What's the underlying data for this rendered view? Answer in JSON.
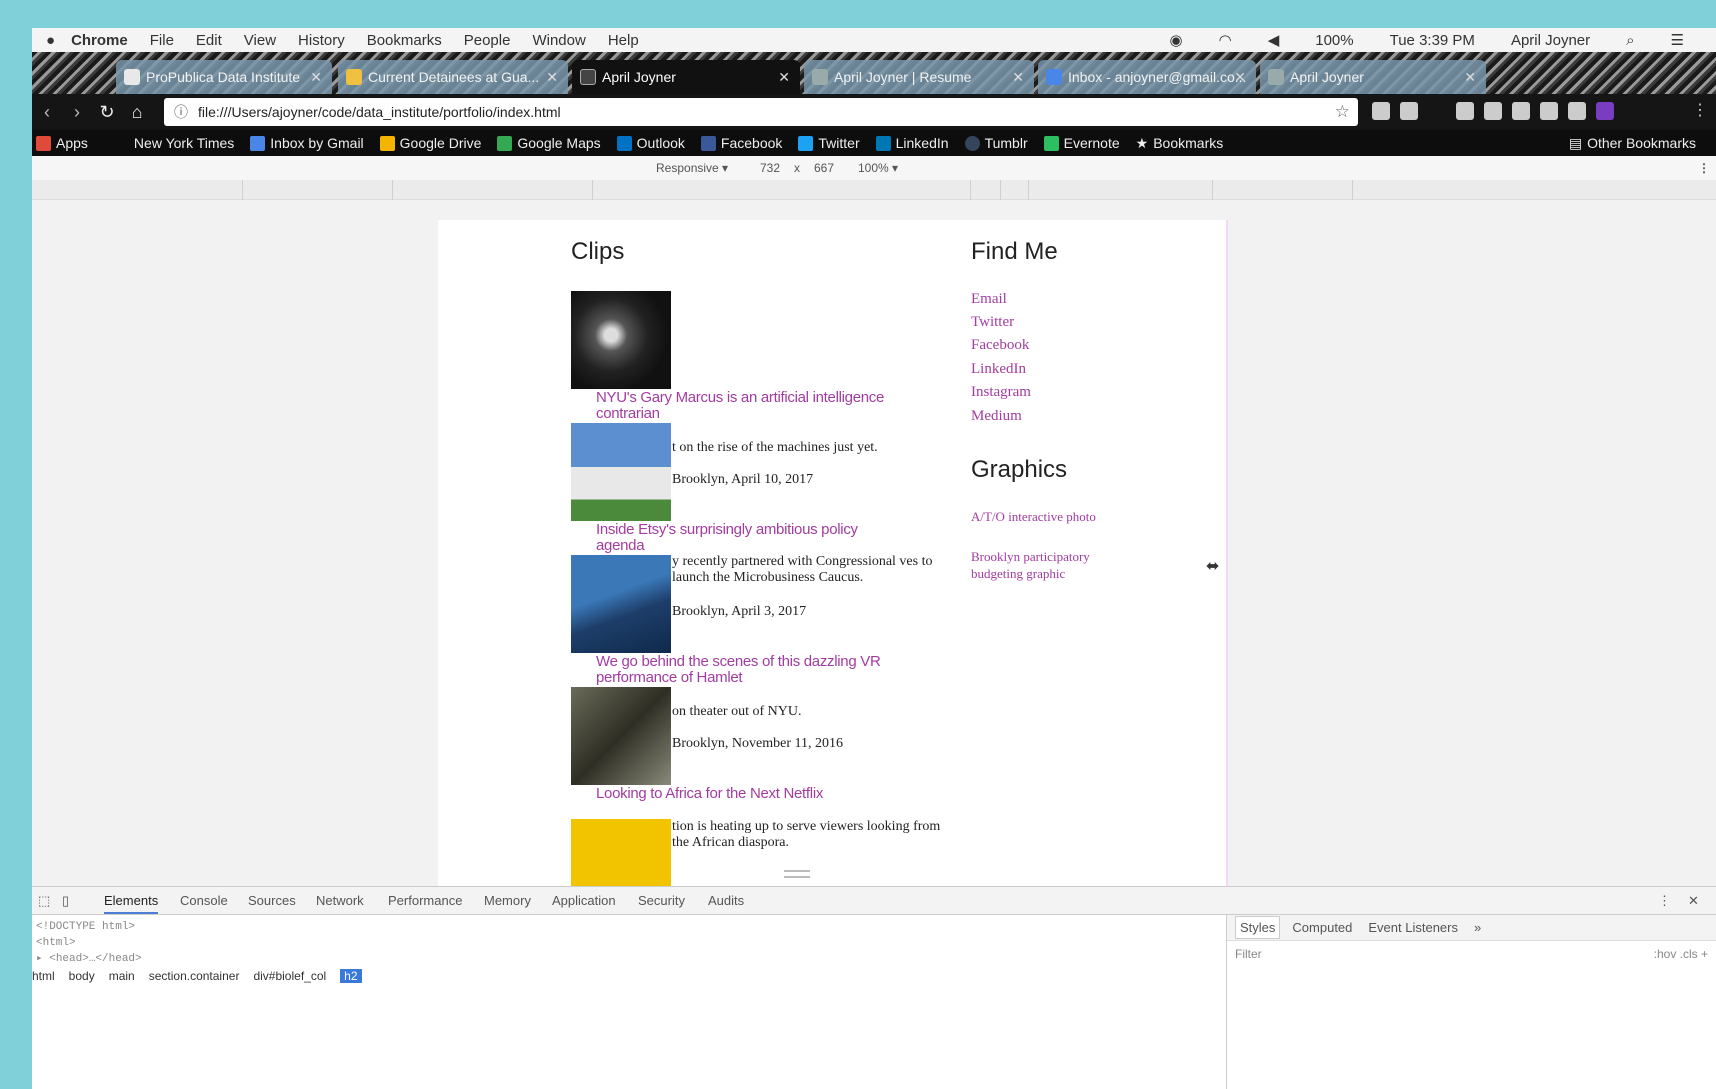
{
  "menubar": {
    "apple": "",
    "items": [
      "Chrome",
      "File",
      "Edit",
      "View",
      "History",
      "Bookmarks",
      "People",
      "Window",
      "Help"
    ],
    "battery": "100%",
    "clock": "Tue 3:39 PM",
    "user": "April Joyner"
  },
  "tabs": [
    {
      "label": "ProPublica Data Institute"
    },
    {
      "label": "Current Detainees at Gua..."
    },
    {
      "label": "April Joyner"
    },
    {
      "label": "April Joyner | Resume"
    },
    {
      "label": "Inbox - anjoyner@gmail.co..."
    },
    {
      "label": "April Joyner"
    }
  ],
  "toolbar": {
    "url": "file:///Users/ajoyner/code/data_institute/portfolio/index.html"
  },
  "bookmarks": [
    {
      "label": "Apps",
      "color": "#e04a3a"
    },
    {
      "label": "New York Times",
      "color": ""
    },
    {
      "label": "Inbox by Gmail",
      "color": "#4a86e8"
    },
    {
      "label": "Google Drive",
      "color": "#f4b400"
    },
    {
      "label": "Google Maps",
      "color": "#34a853"
    },
    {
      "label": "Outlook",
      "color": "#0072c6"
    },
    {
      "label": "Facebook",
      "color": "#3b5998"
    },
    {
      "label": "Twitter",
      "color": "#1da1f2"
    },
    {
      "label": "LinkedIn",
      "color": "#0077b5"
    },
    {
      "label": "Tumblr",
      "color": "#35465c"
    },
    {
      "label": "Evernote",
      "color": "#2dbe60"
    },
    {
      "label": "Bookmarks",
      "color": ""
    }
  ],
  "other_bookmarks": "Other Bookmarks",
  "device": {
    "mode": "Responsive",
    "width": "732",
    "times": "x",
    "height": "667",
    "zoom": "100%"
  },
  "page": {
    "clips_heading": "Clips",
    "findme_heading": "Find Me",
    "graphics_heading": "Graphics",
    "clips": [
      {
        "link": "NYU's Gary Marcus is an artificial intelligence contrarian",
        "desc": "",
        "date": ""
      },
      {
        "link": "",
        "desc": "t on the rise of the machines just yet.",
        "date": "Brooklyn, April 10, 2017"
      },
      {
        "link": "Inside Etsy's surprisingly ambitious policy agenda",
        "desc": "y recently partnered with Congressional ves to launch the Microbusiness Caucus.",
        "date": "Brooklyn, April 3, 2017"
      },
      {
        "link": "We go behind the scenes of this dazzling VR performance of Hamlet",
        "desc": "on theater out of NYU.",
        "date": "Brooklyn, November 11, 2016"
      },
      {
        "link": "Looking to Africa for the Next Netflix",
        "desc": "tion is heating up to serve viewers looking from the African diaspora.",
        "date": ""
      }
    ],
    "findme_links": [
      "Email",
      "Twitter",
      "Facebook",
      "LinkedIn",
      "Instagram",
      "Medium"
    ],
    "graphics_links": [
      "A/T/O interactive photo",
      "Brooklyn participatory budgeting graphic"
    ]
  },
  "devtools": {
    "tabs": [
      "Elements",
      "Console",
      "Sources",
      "Network",
      "Performance",
      "Memory",
      "Application",
      "Security",
      "Audits"
    ],
    "code": [
      "<!DOCTYPE html>",
      "<html>",
      "▸ <head>…</head>"
    ],
    "breadcrumb": [
      "html",
      "body",
      "main",
      "section.container",
      "div#biolef_col",
      "h2"
    ],
    "styles_tabs": [
      "Styles",
      "Computed",
      "Event Listeners"
    ],
    "filter_placeholder": "Filter",
    "filter_right": ":hov .cls +"
  },
  "colors": {
    "link": "#a23ca0",
    "accent": "#3879d9"
  }
}
